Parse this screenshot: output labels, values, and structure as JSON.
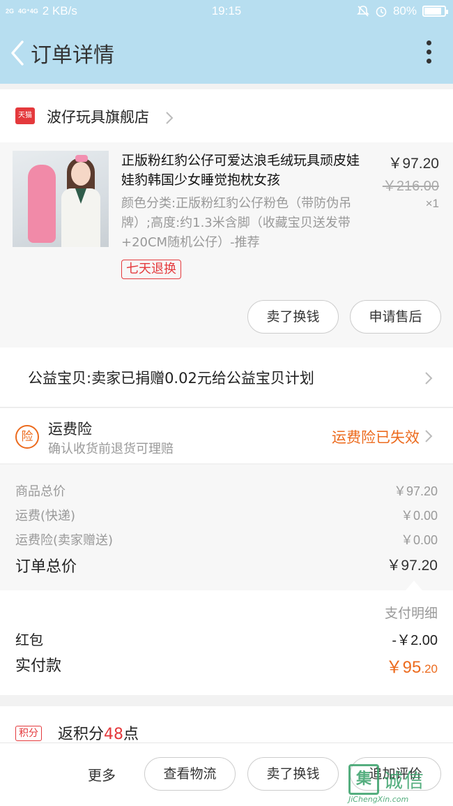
{
  "status_bar": {
    "signal": "2G",
    "signal2": "4G⁺4G",
    "speed": "2 KB/s",
    "time": "19:15",
    "battery_percent": "80%",
    "battery_level": 0.8
  },
  "header": {
    "title": "订单详情"
  },
  "store": {
    "badge": "天猫",
    "name": "波仔玩具旗舰店"
  },
  "product": {
    "title": "正版粉红豹公仔可爱达浪毛绒玩具顽皮娃娃豹韩国少女睡觉抱枕女孩",
    "attributes": "颜色分类:正版粉红豹公仔粉色（带防伪吊牌）;高度:约1.3米含脚（收藏宝贝送发带+20CM随机公仔）-推荐",
    "price": "￥97.20",
    "original_price": "￥216.00",
    "quantity": "×1",
    "tag": "七天退换",
    "btn_sell": "卖了换钱",
    "btn_aftersale": "申请售后"
  },
  "charity": {
    "text": "公益宝贝:卖家已捐赠0.02元给公益宝贝计划"
  },
  "insurance": {
    "icon": "险",
    "title": "运费险",
    "subtitle": "确认收货前退货可理赔",
    "status": "运费险已失效"
  },
  "costs": {
    "goods_label": "商品总价",
    "goods_value": "￥97.20",
    "shipping_label": "运费(快递)",
    "shipping_value": "￥0.00",
    "insurance_label": "运费险(卖家赠送)",
    "insurance_value": "￥0.00",
    "total_label": "订单总价",
    "total_value": "￥97.20"
  },
  "payment": {
    "detail_label": "支付明细",
    "redpacket_label": "红包",
    "redpacket_value": "-￥2.00",
    "paid_label": "实付款",
    "paid_value_main": "￥95",
    "paid_value_cents": ".20"
  },
  "points": {
    "tag": "积分",
    "text_prefix": "返积分",
    "num": "48",
    "text_suffix": "点"
  },
  "bottom_bar": {
    "more": "更多",
    "btn_logistics": "查看物流",
    "btn_sell": "卖了换钱",
    "btn_review": "追加评价"
  },
  "watermark": {
    "box": "集",
    "cn": "诚信",
    "en": "JiChengXin.com"
  },
  "colors": {
    "accent_orange": "#ec6b1e",
    "tmall_red": "#e4393c",
    "header_bg": "#b7def0"
  }
}
